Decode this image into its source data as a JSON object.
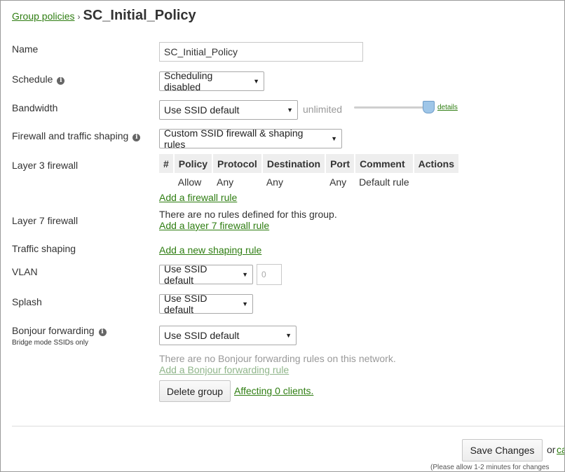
{
  "breadcrumb": {
    "parent": "Group policies",
    "separator": "›",
    "current": "SC_Initial_Policy"
  },
  "fields": {
    "name": {
      "label": "Name",
      "value": "SC_Initial_Policy"
    },
    "schedule": {
      "label": "Schedule",
      "value": "Scheduling disabled"
    },
    "bandwidth": {
      "label": "Bandwidth",
      "value": "Use SSID default",
      "limit_text": "unlimited",
      "details_link": "details",
      "slider_level": 1.0
    },
    "firewall": {
      "label": "Firewall and traffic shaping",
      "value": "Custom SSID firewall & shaping rules"
    },
    "layer3": {
      "label": "Layer 3 firewall",
      "columns": [
        "#",
        "Policy",
        "Protocol",
        "Destination",
        "Port",
        "Comment",
        "Actions"
      ],
      "rows": [
        {
          "num": "",
          "policy": "Allow",
          "protocol": "Any",
          "destination": "Any",
          "port": "Any",
          "comment": "Default rule",
          "actions": ""
        }
      ],
      "add_link": "Add a firewall rule"
    },
    "layer7": {
      "label": "Layer 7 firewall",
      "empty_text": "There are no rules defined for this group.",
      "add_link": "Add a layer 7 firewall rule"
    },
    "traffic_shaping": {
      "label": "Traffic shaping",
      "add_link": "Add a new shaping rule"
    },
    "vlan": {
      "label": "VLAN",
      "value": "Use SSID default",
      "number_placeholder": "0"
    },
    "splash": {
      "label": "Splash",
      "value": "Use SSID default"
    },
    "bonjour": {
      "label": "Bonjour forwarding",
      "sublabel": "Bridge mode SSIDs only",
      "value": "Use SSID default",
      "empty_text": "There are no Bonjour forwarding rules on this network.",
      "add_link": "Add a Bonjour forwarding rule"
    }
  },
  "actions": {
    "delete_label": "Delete group",
    "affecting_link": "Affecting 0 clients.",
    "save_label": "Save Changes",
    "or_text": "or",
    "cancel_link": "ca",
    "note": "(Please allow 1-2 minutes for changes"
  },
  "icons": {
    "info": "info-icon",
    "caret": "caret-down-icon"
  },
  "colors": {
    "link": "#2e7d11",
    "muted": "#999999"
  }
}
